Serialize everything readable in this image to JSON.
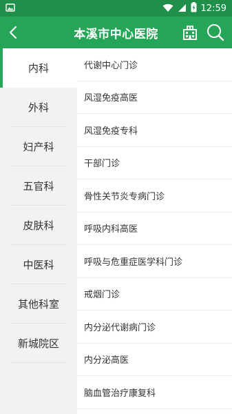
{
  "status_bar": {
    "time": "12:59"
  },
  "header": {
    "title": "本溪市中心医院"
  },
  "sidebar": {
    "items": [
      {
        "label": "内科",
        "active": true
      },
      {
        "label": "外科",
        "active": false
      },
      {
        "label": "妇产科",
        "active": false
      },
      {
        "label": "五官科",
        "active": false
      },
      {
        "label": "皮肤科",
        "active": false
      },
      {
        "label": "中医科",
        "active": false
      },
      {
        "label": "其他科室",
        "active": false
      },
      {
        "label": "新城院区",
        "active": false
      }
    ]
  },
  "departments": [
    "代谢中心门诊",
    "风湿免疫高医",
    "风湿免疫专科",
    "干部门诊",
    "骨性关节炎专病门诊",
    "呼吸内科高医",
    "呼吸与危重症医学科门诊",
    "戒烟门诊",
    "内分泌代谢病门诊",
    "内分泌高医",
    "脑血管治疗康复科"
  ],
  "colors": {
    "accent": "#25a558",
    "status_bar": "#1f8f4a",
    "sidebar_bg": "#f2f2f2"
  },
  "icons": {
    "back": "chevron-left-icon",
    "hospital": "hospital-building-icon",
    "search": "search-icon"
  }
}
